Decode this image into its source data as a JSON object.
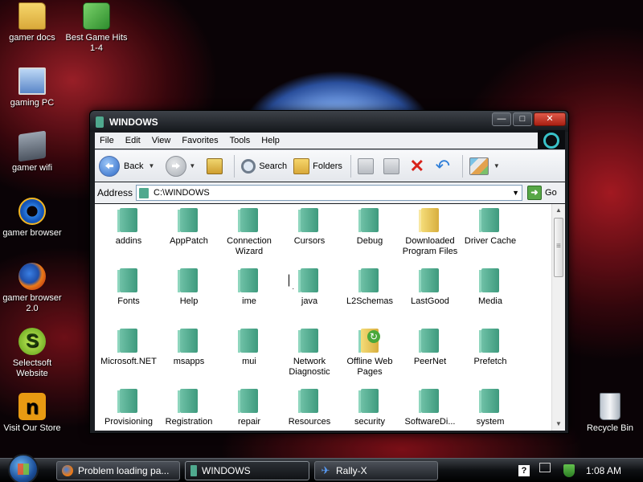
{
  "desktop": {
    "icons": [
      {
        "label": "gamer docs"
      },
      {
        "label": "Best Game Hits 1-4"
      },
      {
        "label": "gaming PC"
      },
      {
        "label": "gamer wifi"
      },
      {
        "label": "gamer browser"
      },
      {
        "label": "gamer browser 2.0"
      },
      {
        "label": "Selectsoft Website"
      },
      {
        "label": "Visit Our Store"
      },
      {
        "label": "Recycle Bin"
      }
    ]
  },
  "window": {
    "title": "WINDOWS",
    "controls": {
      "minimize": "—",
      "maximize": "□",
      "close": "✕"
    },
    "menu": [
      "File",
      "Edit",
      "View",
      "Favorites",
      "Tools",
      "Help"
    ],
    "toolbar": {
      "back_label": "Back",
      "search_label": "Search",
      "folders_label": "Folders"
    },
    "address": {
      "label": "Address",
      "value": "C:\\WINDOWS",
      "go_label": "Go"
    },
    "folders": [
      {
        "name": "addins"
      },
      {
        "name": "AppPatch"
      },
      {
        "name": "Connection Wizard"
      },
      {
        "name": "Cursors"
      },
      {
        "name": "Debug"
      },
      {
        "name": "Downloaded Program Files"
      },
      {
        "name": "Driver Cache"
      },
      {
        "name": "Fonts"
      },
      {
        "name": "Help"
      },
      {
        "name": "ime"
      },
      {
        "name": "java"
      },
      {
        "name": "L2Schemas"
      },
      {
        "name": "LastGood"
      },
      {
        "name": "Media"
      },
      {
        "name": "Microsoft.NET"
      },
      {
        "name": "msapps"
      },
      {
        "name": "mui"
      },
      {
        "name": "Network Diagnostic"
      },
      {
        "name": "Offline Web Pages"
      },
      {
        "name": "PeerNet"
      },
      {
        "name": "Prefetch"
      },
      {
        "name": "Provisioning"
      },
      {
        "name": "Registration"
      },
      {
        "name": "repair"
      },
      {
        "name": "Resources"
      },
      {
        "name": "security"
      },
      {
        "name": "SoftwareDi..."
      },
      {
        "name": "system"
      }
    ]
  },
  "taskbar": {
    "tasks": [
      {
        "label": "Problem loading pa..."
      },
      {
        "label": "WINDOWS"
      },
      {
        "label": "Rally-X"
      }
    ],
    "tray": {
      "help": "?",
      "clock": "1:08 AM"
    }
  },
  "icons": {
    "start": "windows-orb-icon",
    "folder": "folder-icon",
    "back": "back-arrow-icon",
    "forward": "forward-arrow-icon",
    "up": "folder-up-icon",
    "search": "search-icon",
    "folders": "folders-icon",
    "delete": "delete-icon",
    "undo": "undo-icon",
    "views": "views-icon",
    "go": "go-arrow-icon"
  },
  "colors": {
    "folder_teal": "#4fa98e",
    "folder_yellow": "#e3bd4f",
    "titlebar": "#1b1e22",
    "taskbar": "#0e1013"
  }
}
